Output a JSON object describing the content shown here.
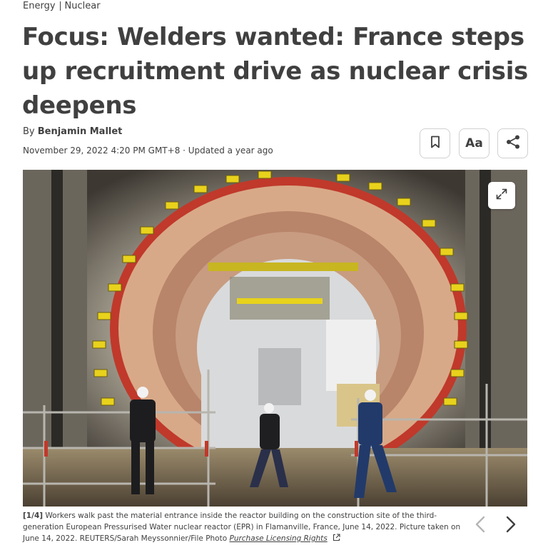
{
  "breadcrumb": {
    "section": "Energy",
    "subsection": "Nuclear"
  },
  "headline": "Focus: Welders wanted: France steps up recruitment drive as nuclear crisis deepens",
  "byline": {
    "prefix": "By ",
    "author": "Benjamin Mallet"
  },
  "dateline": "November 29, 2022 4:20 PM GMT+8 · Updated a year ago",
  "toolbar": {
    "text_size_label": "Aa"
  },
  "icons": {
    "bookmark": "bookmark-icon",
    "share": "share-icon",
    "expand": "expand-icon",
    "prev": "chevron-left-icon",
    "next": "chevron-right-icon",
    "external": "external-link-icon"
  },
  "caption": {
    "index": "[1/4]",
    "text": " Workers walk past the material entrance inside the reactor building on the construction site of the third-generation European Pressurised Water nuclear reactor (EPR) in Flamanville, France, June 14, 2022. Picture taken on June 14, 2022. REUTERS/Sarah Meyssonnier/File Photo ",
    "license_link": "Purchase Licensing Rights"
  },
  "colors": {
    "text": "#404040",
    "border": "#d0d0d0",
    "ring_red": "#c0392b",
    "crane_yellow": "#e8d21c"
  }
}
